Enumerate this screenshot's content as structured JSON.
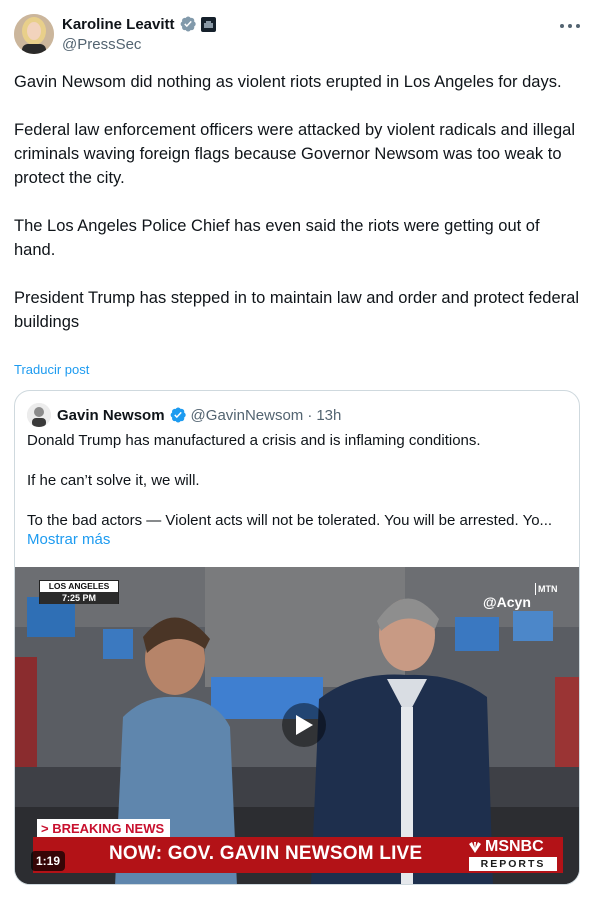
{
  "author": {
    "display_name": "Karoline Leavitt",
    "handle": "@PressSec",
    "verified_icon": "verified-badge-icon",
    "affiliation_icon": "white-house-badge-icon"
  },
  "tweet": {
    "paragraphs": [
      "Gavin Newsom did nothing as violent riots erupted in Los Angeles for days.",
      "Federal law enforcement officers were attacked by violent radicals and illegal criminals waving foreign flags because Governor Newsom was too weak to protect the city.",
      "The Los Angeles Police Chief has even said the riots were getting out of hand.",
      "President Trump has stepped in to maintain law and order and protect federal buildings"
    ],
    "translate_label": "Traducir post"
  },
  "quoted": {
    "display_name": "Gavin Newsom",
    "handle": "@GavinNewsom",
    "separator": "·",
    "time": "13h",
    "paragraphs": [
      "Donald Trump has manufactured a crisis and is inflaming conditions.",
      "If he can’t solve it, we will.",
      "To the bad actors — Violent acts will not be tolerated. You will be arrested. Yo..."
    ],
    "show_more": "Mostrar más",
    "video": {
      "location": "LOS ANGELES",
      "time": "7:25 PM",
      "watermark": "@Acyn",
      "watermark_side": "MTN",
      "breaking_label": "> BREAKING NEWS",
      "ticker": "NOW: GOV. GAVIN NEWSOM LIVE",
      "network": "MSNBC",
      "network_sub": "REPORTS",
      "duration": "1:19"
    }
  },
  "colors": {
    "accent": "#1d9bf0",
    "text": "#0f1419",
    "muted": "#536471",
    "ticker_red": "#b31217"
  }
}
